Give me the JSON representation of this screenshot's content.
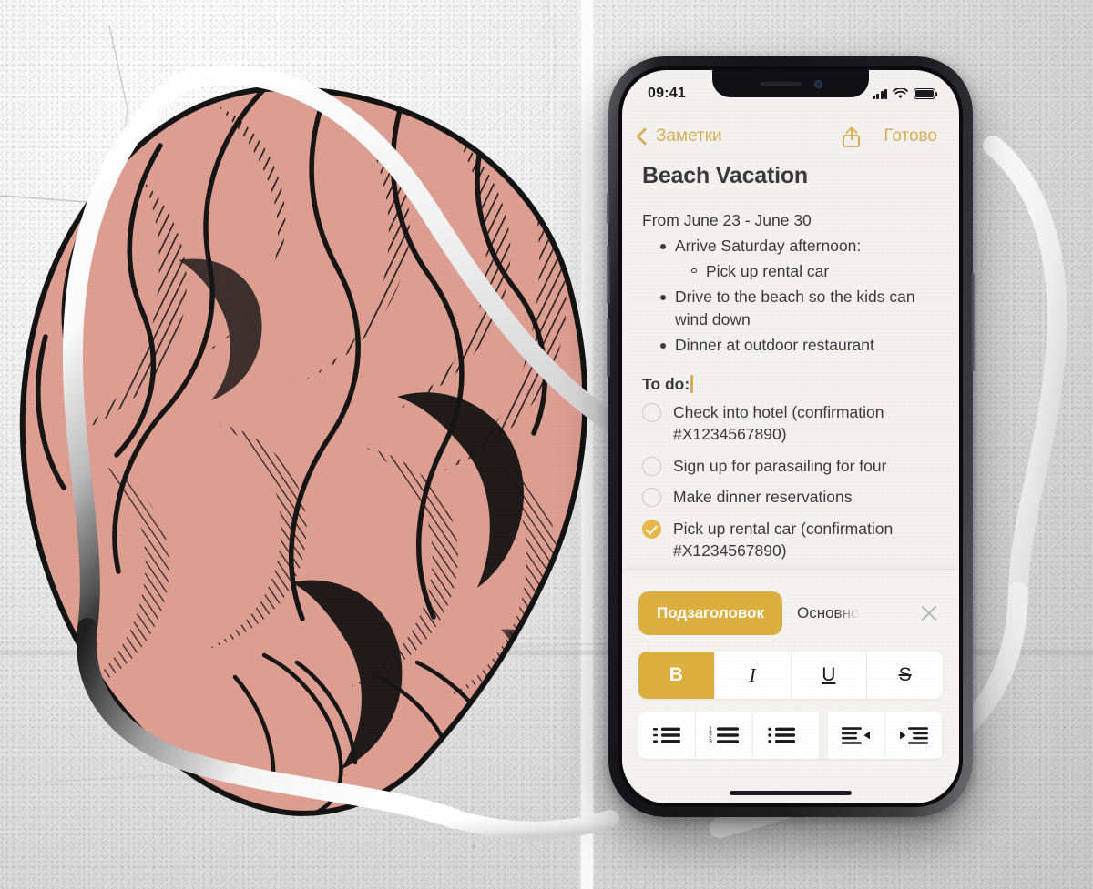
{
  "phone": {
    "status_bar": {
      "time": "09:41",
      "signal_icon": "cellular-bars-icon",
      "wifi_icon": "wifi-icon",
      "battery_icon": "battery-full-icon"
    },
    "nav_bar": {
      "back_label": "Заметки",
      "back_icon": "chevron-left-icon",
      "share_icon": "share-icon",
      "done_label": "Готово"
    },
    "note": {
      "title": "Beach Vacation",
      "intro": "From June 23 - June 30",
      "bullets": [
        {
          "text": "Arrive Saturday afternoon:",
          "sub": [
            "Pick up rental car"
          ]
        },
        {
          "text": "Drive to the beach so the kids can wind down",
          "sub": []
        },
        {
          "text": "Dinner at outdoor restaurant",
          "sub": []
        }
      ],
      "todo_heading": "To do:",
      "checklist": [
        {
          "text": "Check into hotel (confirmation #X1234567890)",
          "checked": false
        },
        {
          "text": "Sign up for parasailing for four",
          "checked": false
        },
        {
          "text": "Make dinner reservations",
          "checked": false
        },
        {
          "text": "Pick up rental car (confirmation #X1234567890)",
          "checked": true
        }
      ]
    },
    "format_toolbar": {
      "style_active": "Подзаголовок",
      "style_next": "Основно",
      "close_icon": "close-icon",
      "text_styles": [
        {
          "label": "B",
          "name": "bold-button",
          "active": true
        },
        {
          "label": "I",
          "name": "italic-button",
          "active": false
        },
        {
          "label": "U",
          "name": "underline-button",
          "active": false
        },
        {
          "label": "S",
          "name": "strikethrough-button",
          "active": false
        }
      ],
      "list_tools": [
        {
          "name": "dashed-list-button"
        },
        {
          "name": "numbered-list-button"
        },
        {
          "name": "bulleted-list-button"
        },
        {
          "name": "outdent-button"
        },
        {
          "name": "indent-button"
        }
      ]
    }
  },
  "colors": {
    "accent_gold": "#d9ae56",
    "pill_gold": "#dcb040",
    "check_gold": "#e8b94a",
    "text_dark": "#3a3a3c",
    "screen_bg": "#f2f1ef",
    "brain_pink": "#dfa093",
    "ink_black": "#141414"
  }
}
